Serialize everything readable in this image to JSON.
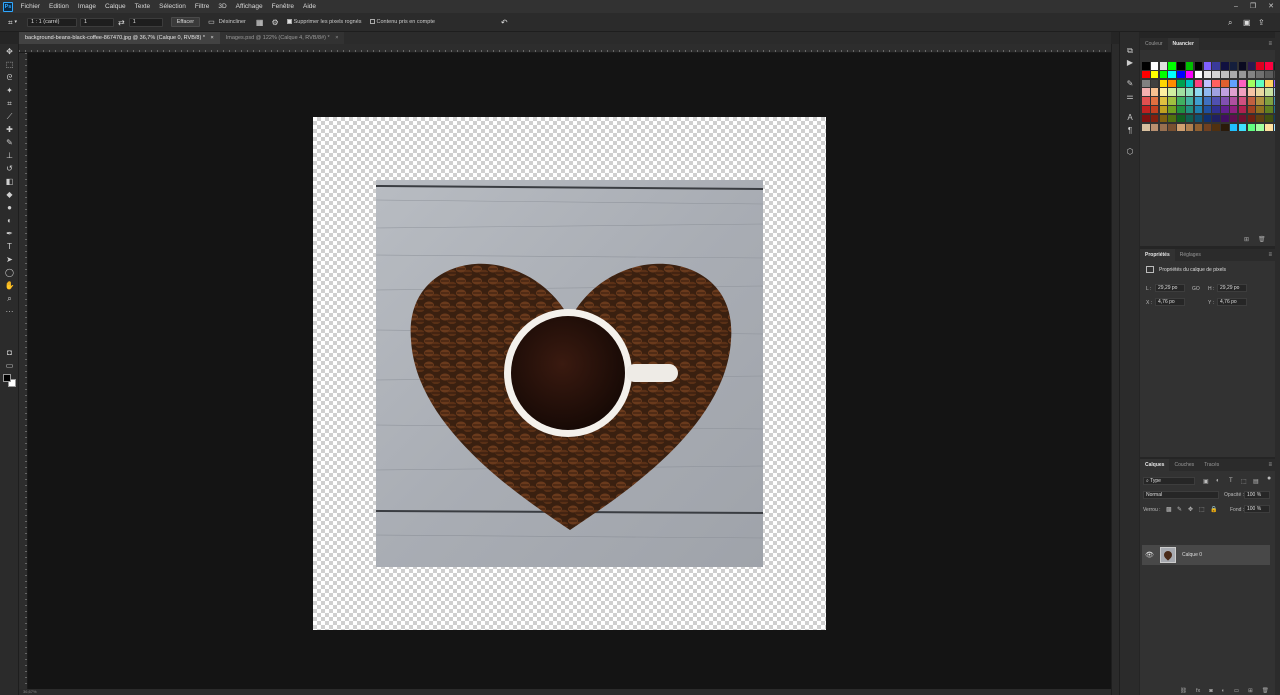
{
  "app": {
    "logo": "Ps"
  },
  "menubar": {
    "items": [
      "Fichier",
      "Edition",
      "Image",
      "Calque",
      "Texte",
      "Sélection",
      "Filtre",
      "3D",
      "Affichage",
      "Fenêtre",
      "Aide"
    ],
    "window_controls": {
      "minimize": "–",
      "restore": "❐",
      "close": "✕"
    }
  },
  "options": {
    "ratio_label": "1 : 1 (carré)",
    "width_value": "1",
    "height_value": "1",
    "clear_label": "Effacer",
    "straighten_label": "Désincliner",
    "delete_cropped_label": "Supprimer les pixels rognés",
    "content_aware_label": "Contenu pris en compte",
    "icons": {
      "crop": "crop-icon",
      "swap": "swap-icon",
      "grid": "grid-overlay-icon",
      "settings": "gear-icon",
      "reset": "undo-icon",
      "search": "search-icon",
      "workspace": "workspace-icon",
      "share": "share-icon"
    }
  },
  "tabs": [
    {
      "label": "background-beans-black-coffee-867470.jpg @ 36,7% (Calque 0, RVB/8) *",
      "close": "×",
      "active": true
    },
    {
      "label": "Images.psd @ 122% (Calque 4, RVB/8#) *",
      "close": "×",
      "active": false
    }
  ],
  "tools": [
    "move-tool-icon",
    "marquee-tool-icon",
    "lasso-tool-icon",
    "magic-wand-icon",
    "crop-tool-icon",
    "eyedropper-icon",
    "healing-brush-icon",
    "brush-icon",
    "clone-stamp-icon",
    "history-brush-icon",
    "eraser-icon",
    "paint-bucket-icon",
    "blur-icon",
    "dodge-icon",
    "pen-tool-icon",
    "type-tool-icon",
    "path-select-icon",
    "ellipse-tool-icon",
    "hand-tool-icon",
    "zoom-tool-icon",
    "more-tools-icon"
  ],
  "colors": {
    "foreground": "#000000",
    "background": "#ffffff",
    "app_bg": "#252525",
    "canvas_bg": "#141414",
    "panel_bg": "#323232",
    "accent": "#31a8ff"
  },
  "swatches_panel": {
    "tabs": [
      "Couleur",
      "Nuancier"
    ],
    "active_tab": "Nuancier",
    "colors": [
      "#000000",
      "#ffffff",
      "#e0e0e0",
      "#00ff00",
      "#000000",
      "#00c000",
      "#000000",
      "#8060ff",
      "#3a3a9a",
      "#101040",
      "#141e3c",
      "#0a0a20",
      "#2a1a50",
      "#e00020",
      "#ff0040",
      "#1a1a1a",
      "#ff0000",
      "#ffff00",
      "#00ff00",
      "#00ffff",
      "#0000ff",
      "#ff00ff",
      "#ffffff",
      "#e8e8e8",
      "#d4d4d4",
      "#c0c0c0",
      "#acacac",
      "#989898",
      "#848484",
      "#707070",
      "#5c5c5c",
      "#484848",
      "#808080",
      "#404040",
      "#ffd700",
      "#ff8c00",
      "#00a050",
      "#00c0c0",
      "#ff4080",
      "#c0c0ff",
      "#ff6060",
      "#e06030",
      "#60a0ff",
      "#ff60c0",
      "#a0ff60",
      "#60ffc0",
      "#ffd060",
      "#9060ff",
      "#f4b0b0",
      "#f8c090",
      "#fff0a0",
      "#d0f0a0",
      "#a0e0a0",
      "#90e0c0",
      "#90d8f0",
      "#90b8f0",
      "#a0a0e0",
      "#c0a0e0",
      "#e0a0d0",
      "#f0a0c0",
      "#f4c4a4",
      "#e8d8a0",
      "#c8e0a0",
      "#a0c8e0",
      "#e05050",
      "#e07040",
      "#e0c040",
      "#a0c040",
      "#40b060",
      "#40b0a0",
      "#40a0d0",
      "#4070c0",
      "#5050b0",
      "#8050b0",
      "#b050a0",
      "#d05080",
      "#c06040",
      "#b09040",
      "#80a040",
      "#4090b0",
      "#c02020",
      "#c04020",
      "#c0a020",
      "#70a020",
      "#209040",
      "#209080",
      "#2080b0",
      "#2050a0",
      "#303090",
      "#602090",
      "#902080",
      "#b02050",
      "#a04020",
      "#907020",
      "#608020",
      "#207090",
      "#801010",
      "#802010",
      "#806010",
      "#507010",
      "#106020",
      "#106050",
      "#105070",
      "#103070",
      "#202060",
      "#401060",
      "#601050",
      "#701030",
      "#702010",
      "#604010",
      "#405010",
      "#104060",
      "#d8c0a0",
      "#b89070",
      "#987050",
      "#785030",
      "#d0a070",
      "#b08050",
      "#906030",
      "#704020",
      "#503010",
      "#2a1a0a",
      "#20c0ff",
      "#40e0ff",
      "#60ff80",
      "#a0ffa0",
      "#ffe0a0",
      "#a0e0ff"
    ]
  },
  "properties_panel": {
    "tabs": [
      "Propriétés",
      "Réglages"
    ],
    "active_tab": "Propriétés",
    "title": "Propriétés du calque de pixels",
    "fields": {
      "L_label": "L :",
      "L_value": "29,29 po",
      "H_label": "H :",
      "H_value": "29,29 po",
      "X_label": "X :",
      "X_value": "4,76 po",
      "Y_label": "Y :",
      "Y_value": "4,76 po",
      "link": "GO"
    }
  },
  "layers_panel": {
    "tabs": [
      "Calques",
      "Couches",
      "Tracés"
    ],
    "active_tab": "Calques",
    "filter_label": "Type",
    "blend_mode": "Normal",
    "opacity_label": "Opacité :",
    "opacity_value": "100 %",
    "lock_label": "Verrou :",
    "fill_label": "Fond :",
    "fill_value": "100 %",
    "layers": [
      {
        "name": "Calque 0",
        "visible": true
      }
    ]
  },
  "statusbar": {
    "text": "36,67%"
  }
}
